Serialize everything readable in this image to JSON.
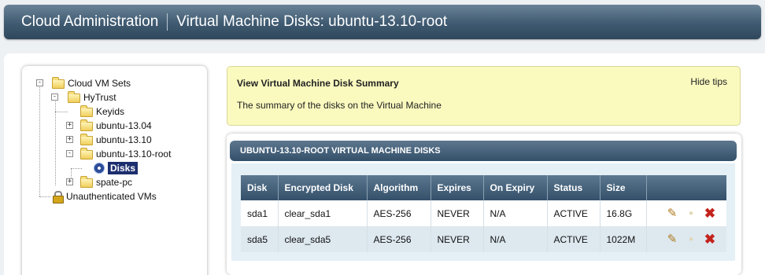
{
  "header": {
    "app_title": "Cloud Administration",
    "page_title": "Virtual Machine Disks: ubuntu-13.10-root"
  },
  "tree": {
    "root": "Cloud VM Sets",
    "hytrust": "HyTrust",
    "keyids": "Keyids",
    "vm1": "ubuntu-13.04",
    "vm2": "ubuntu-13.10",
    "vm3": "ubuntu-13.10-root",
    "disks": "Disks",
    "vm4": "spate-pc",
    "unauth": "Unauthenticated VMs"
  },
  "tips": {
    "title": "View Virtual Machine Disk Summary",
    "hide": "Hide tips",
    "text": "The summary of the disks on the Virtual Machine"
  },
  "disks_panel": {
    "title": "UBUNTU-13.10-ROOT VIRTUAL MACHINE DISKS",
    "columns": [
      "Disk",
      "Encrypted Disk",
      "Algorithm",
      "Expires",
      "On Expiry",
      "Status",
      "Size",
      ""
    ],
    "rows": [
      {
        "disk": "sda1",
        "encrypted": "clear_sda1",
        "algorithm": "AES-256",
        "expires": "NEVER",
        "on_expiry": "N/A",
        "status": "ACTIVE",
        "size": "16.8G"
      },
      {
        "disk": "sda5",
        "encrypted": "clear_sda5",
        "algorithm": "AES-256",
        "expires": "NEVER",
        "on_expiry": "N/A",
        "status": "ACTIVE",
        "size": "1022M"
      }
    ],
    "action_icons": [
      "pencil-icon",
      "unlock-icon",
      "delete-icon"
    ]
  }
}
